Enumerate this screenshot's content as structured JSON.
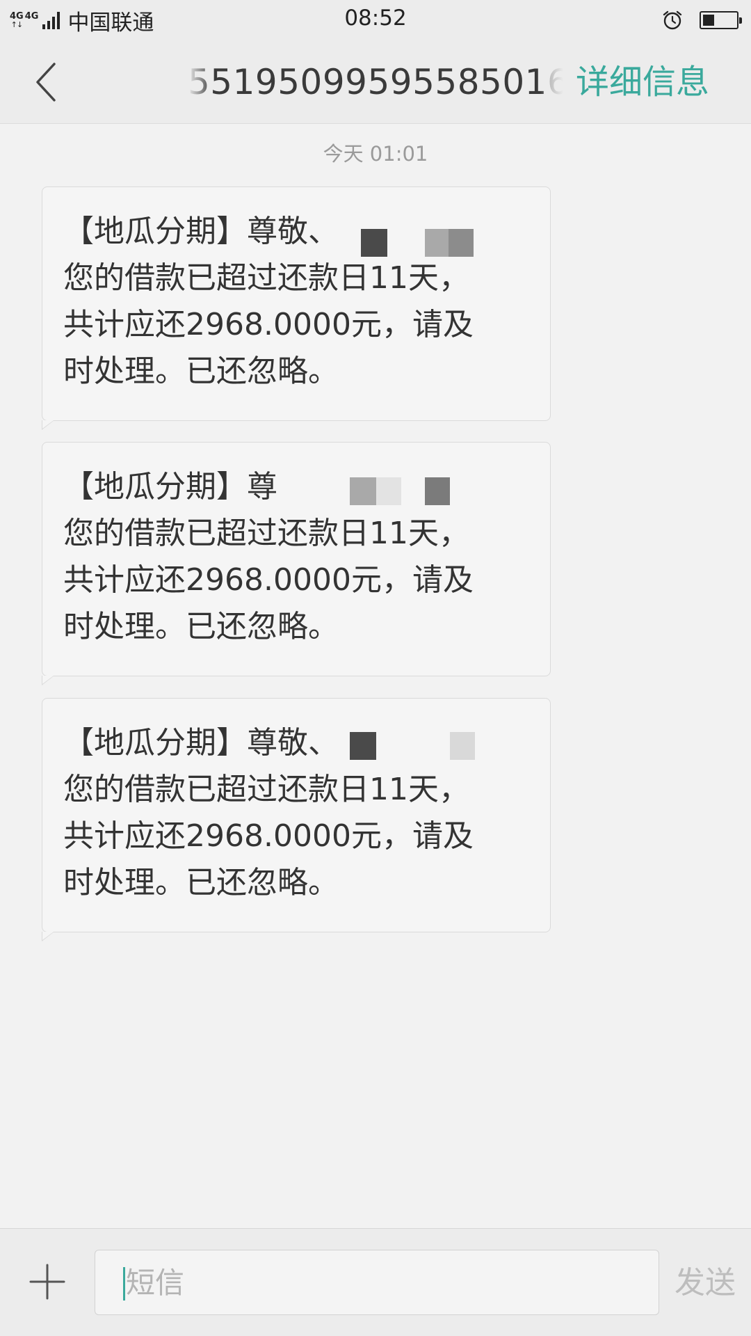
{
  "status_bar": {
    "network": "4G",
    "network2": "4G",
    "carrier": "中国联通",
    "time": "08:52",
    "battery_level": 0.35
  },
  "header": {
    "contact_number": "5519509959558501",
    "contact_last_digit": "6",
    "details_label": "详细信息"
  },
  "conversation": {
    "timestamp": "今天  01:01",
    "messages": [
      {
        "text": "【地瓜分期】尊敬、\n您的借款已超过还款日11天，\n共计应还2968.0000元，请及\n时处理。已还忽略。"
      },
      {
        "text": "【地瓜分期】尊\n您的借款已超过还款日11天，\n共计应还2968.0000元，请及\n时处理。已还忽略。"
      },
      {
        "text": "【地瓜分期】尊敬、\n您的借款已超过还款日11天，\n共计应还2968.0000元，请及\n时处理。已还忽略。"
      }
    ]
  },
  "input_bar": {
    "placeholder": "短信",
    "send_label": "发送"
  },
  "icons": {
    "back": "chevron-left-icon",
    "add": "plus-icon",
    "alarm": "alarm-clock-icon",
    "battery": "battery-icon",
    "signal": "signal-strength-icon"
  },
  "colors": {
    "accent": "#3aa99c",
    "background": "#f2f2f2",
    "header": "#ececec"
  }
}
